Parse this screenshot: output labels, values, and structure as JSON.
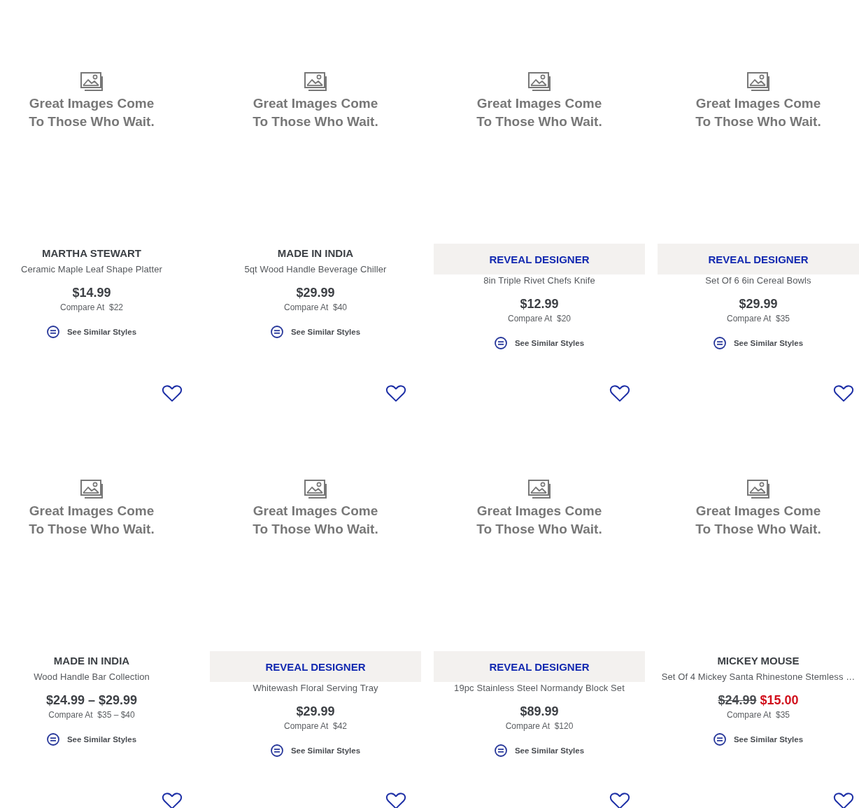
{
  "product_grid": [
    {
      "image_message": "Great Images Come To Those Who Wait.",
      "kind": "brand",
      "brand": "MARTHA STEWART",
      "name": "Ceramic Maple Leaf Shape Platter",
      "price": "$14.99",
      "compare": "Compare At  $22",
      "similar": "See Similar Styles"
    },
    {
      "image_message": "Great Images Come To Those Who Wait.",
      "kind": "brand",
      "brand": "MADE IN INDIA",
      "name": "5qt Wood Handle Beverage Chiller",
      "price": "$29.99",
      "compare": "Compare At  $40",
      "similar": "See Similar Styles"
    },
    {
      "image_message": "Great Images Come To Those Who Wait.",
      "kind": "reveal",
      "brand": "REVEAL DESIGNER",
      "name": "8in Triple Rivet Chefs Knife",
      "price": "$12.99",
      "compare": "Compare At  $20",
      "similar": "See Similar Styles"
    },
    {
      "image_message": "Great Images Come To Those Who Wait.",
      "kind": "reveal",
      "brand": "REVEAL DESIGNER",
      "name": "Set Of 6 6in Cereal Bowls",
      "price": "$29.99",
      "compare": "Compare At  $35",
      "similar": "See Similar Styles"
    },
    {
      "saved": false,
      "image_message": "Great Images Come To Those Who Wait.",
      "kind": "brand",
      "brand": "MADE IN INDIA",
      "name": "Wood Handle Bar Collection",
      "price": "$24.99 – $29.99",
      "compare": "Compare At  $35 – $40",
      "similar": "See Similar Styles"
    },
    {
      "saved": false,
      "image_message": "Great Images Come To Those Who Wait.",
      "kind": "reveal",
      "brand": "REVEAL DESIGNER",
      "name": "Whitewash Floral Serving Tray",
      "price": "$29.99",
      "compare": "Compare At  $42",
      "similar": "See Similar Styles"
    },
    {
      "saved": false,
      "image_message": "Great Images Come To Those Who Wait.",
      "kind": "reveal",
      "brand": "REVEAL DESIGNER",
      "name": "19pc Stainless Steel Normandy Block Set",
      "price": "$89.99",
      "compare": "Compare At  $120",
      "similar": "See Similar Styles"
    },
    {
      "saved": false,
      "image_message": "Great Images Come To Those Who Wait.",
      "kind": "brand",
      "brand": "MICKEY MOUSE",
      "name": "Set Of 4 Mickey Santa Rhinestone Stemless …",
      "price": "$24.99",
      "sale_price": "$15.00",
      "compare": "Compare At  $35",
      "similar": "See Similar Styles"
    },
    {
      "saved": false
    },
    {
      "saved": false
    },
    {
      "saved": false
    },
    {
      "saved": false
    }
  ]
}
